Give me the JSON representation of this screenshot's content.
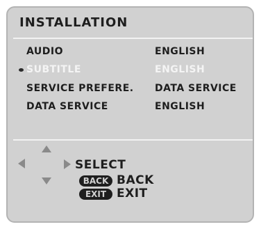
{
  "menu": {
    "title": "INSTALLATION",
    "items": [
      {
        "label": "AUDIO",
        "value": "ENGLISH",
        "selected": false
      },
      {
        "label": "SUBTITLE",
        "value": "ENGLISH",
        "selected": true
      },
      {
        "label": "SERVICE PREFERE.",
        "value": "DATA SERVICE",
        "selected": false
      },
      {
        "label": "DATA SERVICE",
        "value": "ENGLISH",
        "selected": false
      }
    ]
  },
  "legend": {
    "select_label": "SELECT",
    "back_key": "BACK",
    "back_label": "BACK",
    "exit_key": "EXIT",
    "exit_label": "EXIT"
  },
  "colors": {
    "panel": "#d1d1d1",
    "text": "#1e1e1e",
    "highlight_text": "#f4f4f4",
    "arrow": "#8a8a8a"
  }
}
